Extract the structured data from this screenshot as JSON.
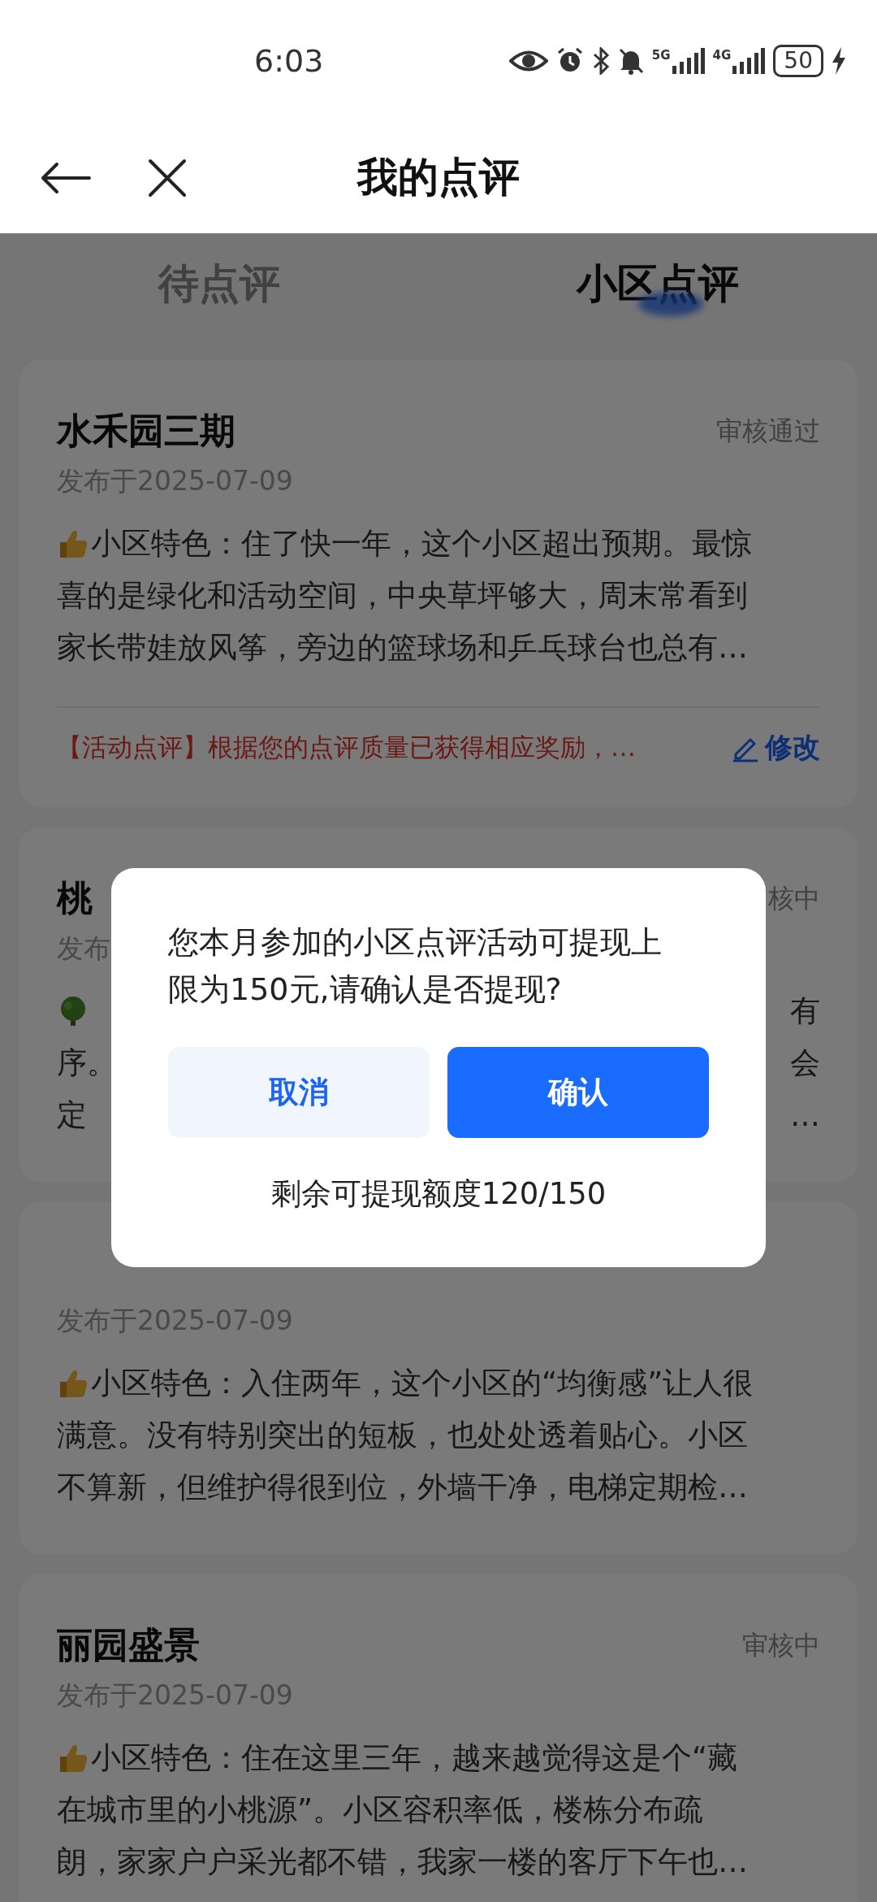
{
  "status_bar": {
    "time": "6:03",
    "networks": [
      {
        "label": "5G"
      },
      {
        "label": "4G"
      }
    ],
    "battery": "50"
  },
  "header": {
    "title": "我的点评"
  },
  "tabs": [
    {
      "label": "待点评",
      "selected": false
    },
    {
      "label": "小区点评",
      "selected": true
    }
  ],
  "reviews": [
    {
      "kind": "thumb",
      "title": "水禾园三期",
      "status": "审核通过",
      "date": "发布于2025-07-09",
      "lines": [
        {
          "left": "小区特色：住了快一年，这个小区超出预期。最惊"
        },
        {
          "left": "喜的是绿化和活动空间，中央草坪够大，周末常看到"
        },
        {
          "left": "家长带娃放风筝，旁边的篮球场和乒乓球台也总有…"
        }
      ],
      "notice": "【活动点评】根据您的点评质量已获得相应奖励，…",
      "edit": "修改"
    },
    {
      "kind": "tree",
      "title": "桃",
      "status": "核中",
      "date": "发布",
      "lines": [
        {
          "right": "有"
        },
        {
          "left": "序。",
          "right": "会"
        },
        {
          "left": "定",
          "right": "…"
        }
      ]
    },
    {
      "kind": "thumb",
      "date": "发布于2025-07-09",
      "lines": [
        {
          "left": "小区特色：入住两年，这个小区的“均衡感”让人很"
        },
        {
          "left": "满意。没有特别突出的短板，也处处透着贴心。小区"
        },
        {
          "left": "不算新，但维护得很到位，外墙干净，电梯定期检…"
        }
      ]
    },
    {
      "kind": "thumb",
      "title": "丽园盛景",
      "status": "审核中",
      "date": "发布于2025-07-09",
      "lines": [
        {
          "left": "小区特色：住在这里三年，越来越觉得这是个“藏"
        },
        {
          "left": "在城市里的小桃源”。小区容积率低，楼栋分布疏"
        },
        {
          "left": "朗，家家户户采光都不错，我家一楼的客厅下午也…"
        }
      ]
    }
  ],
  "dialog": {
    "message": "您本月参加的小区点评活动可提现上限为150元,请确认是否提现?",
    "buttons": [
      {
        "label": "取消",
        "kind": "secondary"
      },
      {
        "label": "确认",
        "kind": "primary"
      }
    ],
    "quota": "剩余可提现额度120/150"
  }
}
